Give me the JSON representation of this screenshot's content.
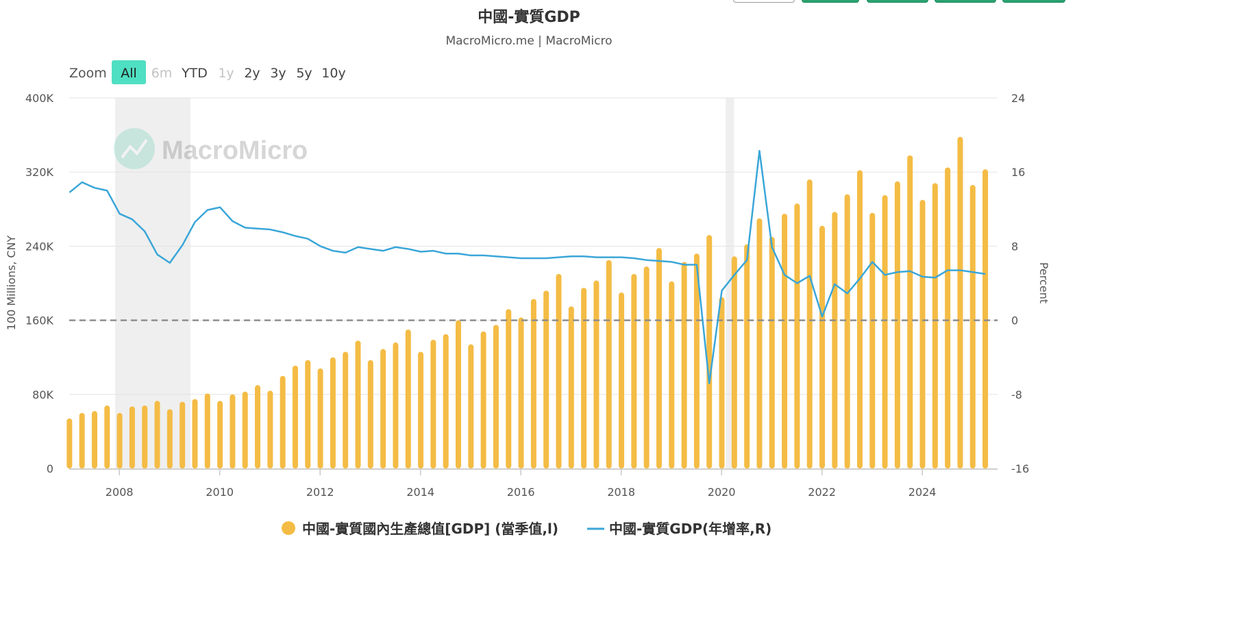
{
  "toolbar": {
    "visible_button_count": 5
  },
  "chart_data": {
    "type": "bar+line",
    "title": "中國-實質GDP",
    "subtitle": "MacroMicro.me | MacroMicro",
    "watermark": "MacroMicro",
    "zoom": {
      "label": "Zoom",
      "buttons": [
        {
          "label": "All",
          "selected": true,
          "enabled": true
        },
        {
          "label": "6m",
          "selected": false,
          "enabled": false
        },
        {
          "label": "YTD",
          "selected": false,
          "enabled": true
        },
        {
          "label": "1y",
          "selected": false,
          "enabled": false
        },
        {
          "label": "2y",
          "selected": false,
          "enabled": true
        },
        {
          "label": "3y",
          "selected": false,
          "enabled": true
        },
        {
          "label": "5y",
          "selected": false,
          "enabled": true
        },
        {
          "label": "10y",
          "selected": false,
          "enabled": true
        }
      ]
    },
    "x_axis": {
      "range": [
        "2007-01",
        "2025-06"
      ],
      "ticks": [
        "2008",
        "2010",
        "2012",
        "2014",
        "2016",
        "2018",
        "2020",
        "2022",
        "2024"
      ]
    },
    "y_left": {
      "label": "100 Millions, CNY",
      "range": [
        0,
        400000
      ],
      "ticks": [
        "0",
        "80K",
        "160K",
        "240K",
        "320K",
        "400K"
      ],
      "tick_values": [
        0,
        80000,
        160000,
        240000,
        320000,
        400000
      ]
    },
    "y_right": {
      "label": "Percent",
      "range": [
        -16,
        24
      ],
      "ticks": [
        "-16",
        "-8",
        "0",
        "8",
        "16",
        "24"
      ],
      "tick_values": [
        -16,
        -8,
        0,
        8,
        16,
        24
      ]
    },
    "grid": true,
    "zero_reference_line": {
      "axis": "right",
      "value": 0,
      "style": "dashed",
      "color": "#8e8e8e"
    },
    "shaded_periods": [
      [
        "2007-12",
        "2009-06"
      ],
      [
        "2020-02",
        "2020-04"
      ]
    ],
    "quarters": [
      "2007Q1",
      "2007Q2",
      "2007Q3",
      "2007Q4",
      "2008Q1",
      "2008Q2",
      "2008Q3",
      "2008Q4",
      "2009Q1",
      "2009Q2",
      "2009Q3",
      "2009Q4",
      "2010Q1",
      "2010Q2",
      "2010Q3",
      "2010Q4",
      "2011Q1",
      "2011Q2",
      "2011Q3",
      "2011Q4",
      "2012Q1",
      "2012Q2",
      "2012Q3",
      "2012Q4",
      "2013Q1",
      "2013Q2",
      "2013Q3",
      "2013Q4",
      "2014Q1",
      "2014Q2",
      "2014Q3",
      "2014Q4",
      "2015Q1",
      "2015Q2",
      "2015Q3",
      "2015Q4",
      "2016Q1",
      "2016Q2",
      "2016Q3",
      "2016Q4",
      "2017Q1",
      "2017Q2",
      "2017Q3",
      "2017Q4",
      "2018Q1",
      "2018Q2",
      "2018Q3",
      "2018Q4",
      "2019Q1",
      "2019Q2",
      "2019Q3",
      "2019Q4",
      "2020Q1",
      "2020Q2",
      "2020Q3",
      "2020Q4",
      "2021Q1",
      "2021Q2",
      "2021Q3",
      "2021Q4",
      "2022Q1",
      "2022Q2",
      "2022Q3",
      "2022Q4",
      "2023Q1",
      "2023Q2",
      "2023Q3",
      "2023Q4",
      "2024Q1",
      "2024Q2",
      "2024Q3",
      "2024Q4",
      "2025Q1",
      "2025Q2"
    ],
    "series": [
      {
        "name": "中國-實質國內生產總值[GDP] (當季值,l)",
        "type": "bar",
        "axis": "left",
        "color": "#f4bc45",
        "values": [
          54000,
          60000,
          62000,
          68000,
          60000,
          67000,
          68000,
          73000,
          64000,
          72000,
          75000,
          81000,
          73000,
          80000,
          83000,
          90000,
          84000,
          100000,
          111000,
          117000,
          108000,
          120000,
          126000,
          138000,
          117000,
          129000,
          136000,
          150000,
          126000,
          139000,
          145000,
          160000,
          134000,
          148000,
          155000,
          172000,
          163000,
          183000,
          192000,
          210000,
          175000,
          195000,
          203000,
          225000,
          190000,
          210000,
          218000,
          238000,
          202000,
          223000,
          232000,
          252000,
          185000,
          229000,
          242000,
          270000,
          250000,
          275000,
          286000,
          312000,
          262000,
          277000,
          296000,
          322000,
          276000,
          295000,
          310000,
          338000,
          290000,
          308000,
          325000,
          358000,
          306000,
          323000
        ]
      },
      {
        "name": "中國-實質GDP(年增率,R)",
        "type": "line",
        "axis": "right",
        "color": "#3aa6d8",
        "values": [
          13.8,
          14.9,
          14.3,
          14.0,
          11.5,
          10.9,
          9.6,
          7.1,
          6.2,
          8.1,
          10.6,
          11.9,
          12.2,
          10.7,
          10.0,
          9.9,
          9.8,
          9.5,
          9.1,
          8.8,
          8.0,
          7.5,
          7.3,
          7.9,
          7.7,
          7.5,
          7.9,
          7.7,
          7.4,
          7.5,
          7.2,
          7.2,
          7.0,
          7.0,
          6.9,
          6.8,
          6.7,
          6.7,
          6.7,
          6.8,
          6.9,
          6.9,
          6.8,
          6.8,
          6.8,
          6.7,
          6.5,
          6.4,
          6.3,
          6.0,
          6.0,
          -6.8,
          3.2,
          4.9,
          6.5,
          18.3,
          7.9,
          4.9,
          4.0,
          4.8,
          0.4,
          3.9,
          2.9,
          4.5,
          6.3,
          4.9,
          5.2,
          5.3,
          4.7,
          4.6,
          5.4,
          5.4,
          5.2,
          5.0
        ]
      }
    ],
    "legend": {
      "position": "bottom-center"
    }
  }
}
